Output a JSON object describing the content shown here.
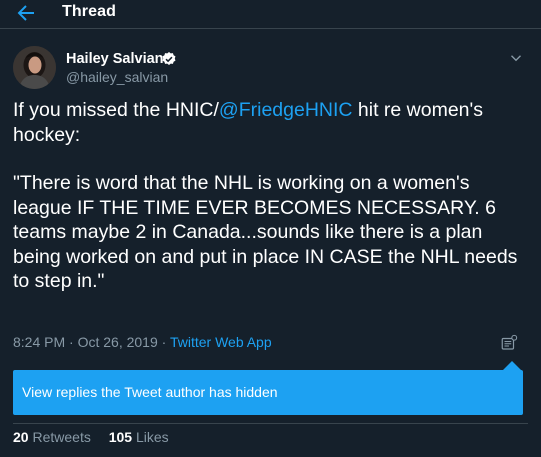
{
  "header": {
    "title": "Thread",
    "back_icon": "arrow-left-icon"
  },
  "author": {
    "name": "Hailey Salvian",
    "handle": "@hailey_salvian",
    "verified_icon": "verified-badge-icon"
  },
  "tweet": {
    "line1_before": "If you missed the HNIC/",
    "mention": "@FriedgeHNIC",
    "line1_after": " hit re women's hockey:",
    "quote": "\"There is word that the NHL is working on a women's league IF THE TIME EVER BECOMES NECESSARY. 6 teams maybe 2 in Canada...sounds like there is a plan being worked on and put in place IN CASE the NHL needs to step in.\""
  },
  "meta": {
    "timestamp": "8:24 PM · Oct 26, 2019",
    "separator": " · ",
    "source": "Twitter Web App"
  },
  "tooltip": {
    "text": "View replies the Tweet author has hidden"
  },
  "stats": {
    "retweets_count": "20",
    "retweets_label": "Retweets",
    "likes_count": "105",
    "likes_label": "Likes"
  },
  "colors": {
    "background": "#15202b",
    "accent": "#1da1f2",
    "secondary_text": "#8899a6",
    "border": "#38444d"
  }
}
